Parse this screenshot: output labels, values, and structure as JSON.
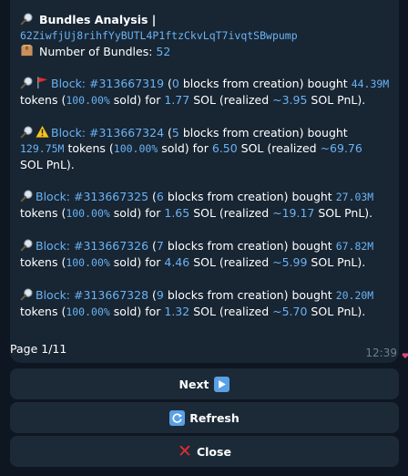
{
  "header": {
    "title": "Bundles Analysis |",
    "address": "62ZiwfjUj8rihfYyBUTL4P1ftzCkvLqT7ivqtSBwpump",
    "bundles_label": "Number of Bundles:",
    "bundles_count": "52"
  },
  "bundles": [
    {
      "prefix": "Block: #313667319",
      "blocks": "0",
      "mid": "blocks from creation) bought",
      "amount": "44.39M",
      "tokens_text": "tokens (",
      "pct": "100.00%",
      "sold_text": "sold) for",
      "sol": "1.77",
      "realized_text": "SOL (realized",
      "pnl": "~3.95",
      "end": "SOL PnL)."
    },
    {
      "prefix": "Block: #313667324",
      "blocks": "5",
      "mid": "blocks from creation) bought",
      "amount": "129.75M",
      "tokens_text": "tokens (",
      "pct": "100.00%",
      "sold_text": "sold) for",
      "sol": "6.50",
      "realized_text": "SOL (realized",
      "pnl": "~69.76",
      "end": "SOL PnL)."
    },
    {
      "prefix": "Block: #313667325",
      "blocks": "6",
      "mid": "blocks from creation) bought",
      "amount": "27.03M",
      "tokens_text": "tokens (",
      "pct": "100.00%",
      "sold_text": "sold) for",
      "sol": "1.65",
      "realized_text": "SOL (realized",
      "pnl": "~19.17",
      "end": "SOL PnL)."
    },
    {
      "prefix": "Block: #313667326",
      "blocks": "7",
      "mid": "blocks from creation) bought",
      "amount": "67.82M",
      "tokens_text": "tokens (",
      "pct": "100.00%",
      "sold_text": "sold) for",
      "sol": "4.46",
      "realized_text": "SOL (realized",
      "pnl": "~5.99",
      "end": "SOL PnL)."
    },
    {
      "prefix": "Block: #313667328",
      "blocks": "9",
      "mid": "blocks from creation) bought",
      "amount": "20.20M",
      "tokens_text": "tokens (",
      "pct": "100.00%",
      "sold_text": "sold) for",
      "sol": "1.32",
      "realized_text": "SOL (realized",
      "pnl": "~5.70",
      "end": "SOL PnL)."
    }
  ],
  "footer": {
    "page": "Page 1/11",
    "time": "12:39"
  },
  "buttons": {
    "next": "Next",
    "refresh": "Refresh",
    "close": "Close"
  },
  "icons": {
    "magnifier": "magnifier-icon",
    "box": "package-icon",
    "flag": "red-flag-icon",
    "warning": "warning-icon"
  },
  "colors": {
    "link": "#6ab3f3",
    "bg": "#0e1621",
    "bubble": "#182533",
    "button": "#1c2a38"
  }
}
